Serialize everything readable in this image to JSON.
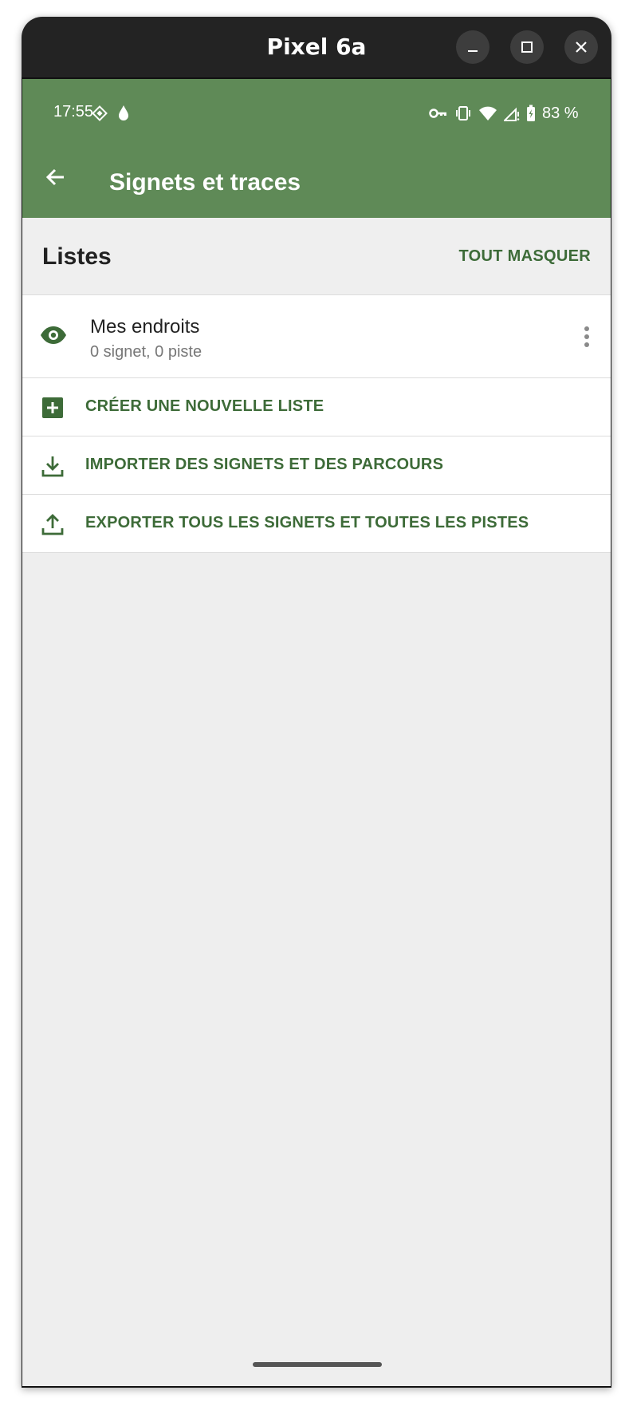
{
  "window": {
    "title": "Pixel 6a"
  },
  "status_bar": {
    "time": "17:55",
    "battery_percent": "83 %"
  },
  "app_bar": {
    "title": "Signets et traces"
  },
  "section": {
    "title": "Listes",
    "hide_all_label": "TOUT MASQUER"
  },
  "lists": [
    {
      "name": "Mes endroits",
      "summary": "0 signet, 0 piste",
      "icon": "eye-icon"
    }
  ],
  "actions": {
    "create_label": "CRÉER UNE NOUVELLE LISTE",
    "import_label": "IMPORTER DES SIGNETS ET DES PARCOURS",
    "export_label": "EXPORTER TOUS LES SIGNETS ET TOUTES LES PISTES"
  },
  "colors": {
    "app_bar": "#5f8a57",
    "accent": "#3d6b38",
    "background": "#eeeeee",
    "titlebar": "#232323"
  }
}
